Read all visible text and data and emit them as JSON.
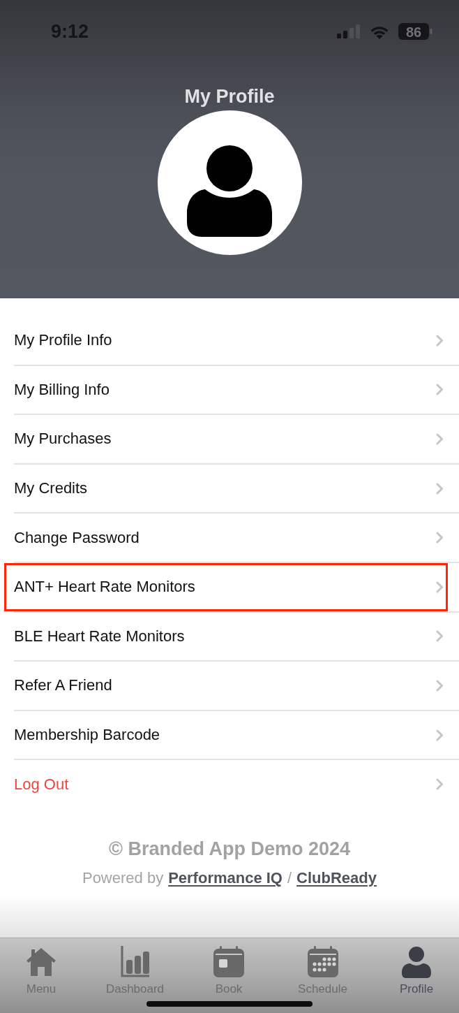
{
  "status_bar": {
    "time": "9:12",
    "battery": "86"
  },
  "header": {
    "title": "My Profile"
  },
  "menu": {
    "items": [
      {
        "label": "My Profile Info",
        "kind": "normal",
        "highlighted": false
      },
      {
        "label": "My Billing Info",
        "kind": "normal",
        "highlighted": false
      },
      {
        "label": "My Purchases",
        "kind": "normal",
        "highlighted": false
      },
      {
        "label": "My Credits",
        "kind": "normal",
        "highlighted": false
      },
      {
        "label": "Change Password",
        "kind": "normal",
        "highlighted": false
      },
      {
        "label": "ANT+ Heart Rate Monitors",
        "kind": "normal",
        "highlighted": true
      },
      {
        "label": "BLE Heart Rate Monitors",
        "kind": "normal",
        "highlighted": false
      },
      {
        "label": "Refer A Friend",
        "kind": "normal",
        "highlighted": false
      },
      {
        "label": "Membership Barcode",
        "kind": "normal",
        "highlighted": false
      },
      {
        "label": "Log Out",
        "kind": "danger",
        "highlighted": false
      }
    ]
  },
  "footer": {
    "copyright": "© Branded App Demo 2024",
    "powered_by": "Powered by",
    "links": [
      {
        "label": "Performance IQ"
      },
      {
        "label": "ClubReady"
      }
    ],
    "separator": "/"
  },
  "tab_bar": {
    "tabs": [
      {
        "label": "Menu",
        "kind": "home",
        "selected": false
      },
      {
        "label": "Dashboard",
        "kind": "chart",
        "selected": false
      },
      {
        "label": "Book",
        "kind": "calendar",
        "selected": false
      },
      {
        "label": "Schedule",
        "kind": "calendar-grid",
        "selected": false
      },
      {
        "label": "Profile",
        "kind": "person",
        "selected": true
      }
    ]
  }
}
